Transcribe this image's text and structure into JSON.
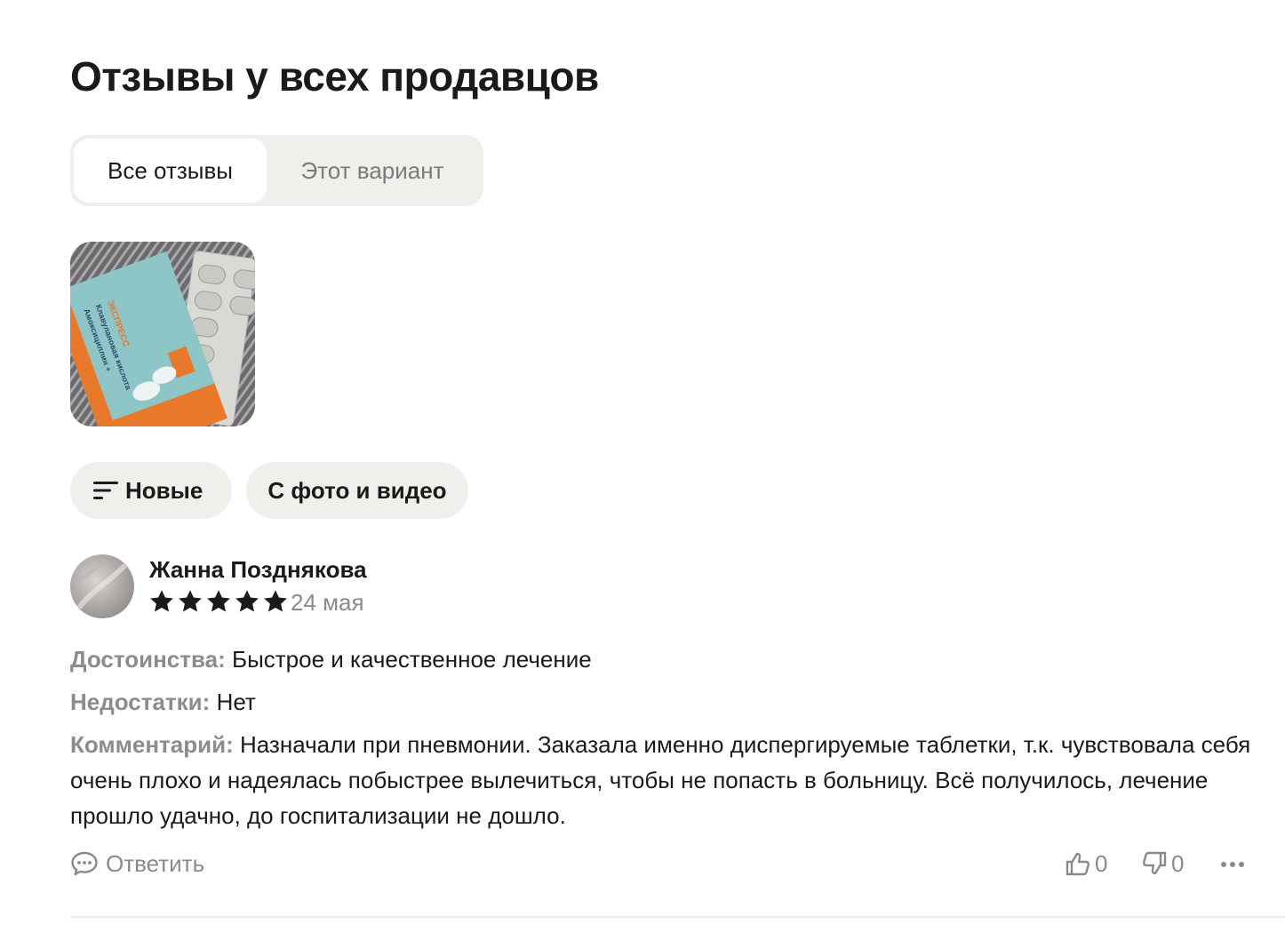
{
  "page": {
    "title": "Отзывы у всех продавцов"
  },
  "tabs": [
    {
      "label": "Все отзывы",
      "active": true
    },
    {
      "label": "Этот вариант",
      "active": false
    }
  ],
  "gallery": {
    "photos": [
      {
        "kind": "product-photo",
        "depicts": "medicine box with blister of tablets"
      }
    ],
    "box_text": {
      "line1": "Амоксициллин +",
      "line2": "Клавулановая кислота",
      "line3": "ЭКСПРЕСС"
    }
  },
  "filters": {
    "sort_label": "Новые",
    "sort_icon": "sort-lines-icon",
    "media_label": "С фото и видео"
  },
  "review": {
    "author": "Жанна Позднякова",
    "rating": 5,
    "rating_max": 5,
    "date": "24 мая",
    "pros_label": "Достоинства:",
    "pros_text": "Быстрое и качественное лечение",
    "cons_label": "Недостатки:",
    "cons_text": "Нет",
    "comment_label": "Комментарий:",
    "comment_text": "Назначали при пневмонии. Заказала именно диспергируемые таблетки, т.к. чувствовала себя очень плохо и надеялась побыстрее вылечиться, чтобы не попасть в больницу. Всё получилось, лечение прошло удачно, до госпитализации не дошло.",
    "reply_label": "Ответить",
    "likes": "0",
    "dislikes": "0"
  },
  "colors": {
    "star": "#1a1a1a",
    "chip_bg": "#f0efeb",
    "muted_text": "#8a8a88"
  }
}
